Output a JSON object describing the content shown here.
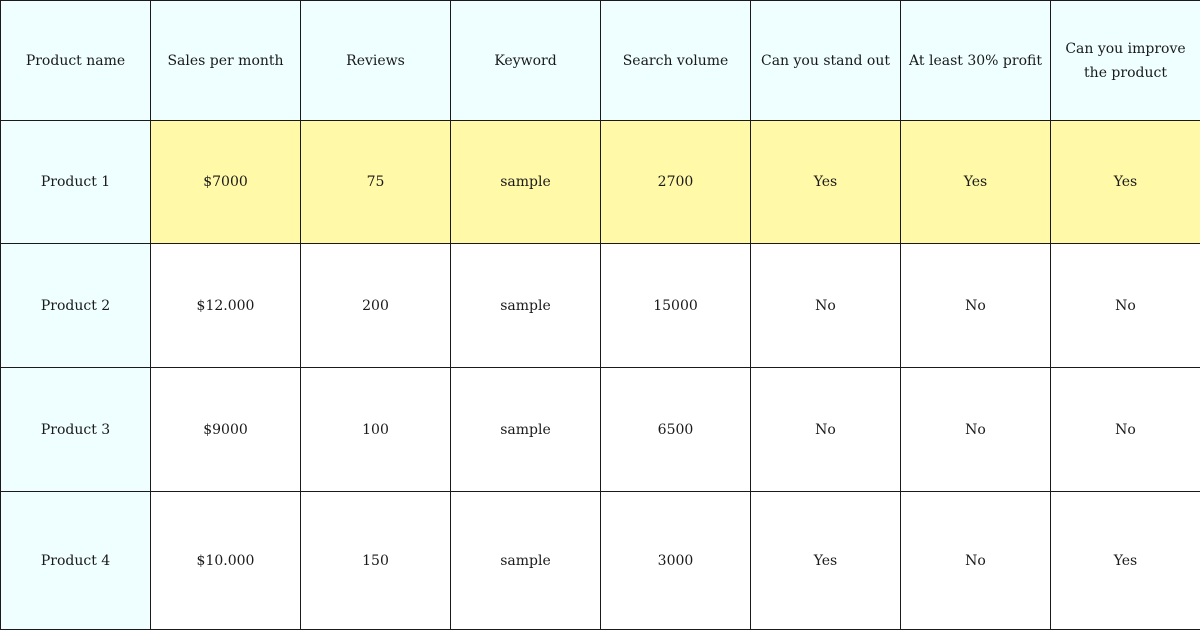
{
  "table": {
    "columns": [
      "Product name",
      "Sales per month",
      "Reviews",
      "Keyword",
      "Search volume",
      "Can you stand out",
      "At least 30% profit",
      "Can you improve the product"
    ],
    "rows": [
      {
        "name": "Product 1",
        "sales": "$7000",
        "reviews": "75",
        "keyword": "sample",
        "search_volume": "2700",
        "stand_out": "Yes",
        "profit_30": "Yes",
        "improve": "Yes",
        "highlighted": true
      },
      {
        "name": "Product 2",
        "sales": "$12.000",
        "reviews": "200",
        "keyword": "sample",
        "search_volume": "15000",
        "stand_out": "No",
        "profit_30": "No",
        "improve": "No",
        "highlighted": false
      },
      {
        "name": "Product 3",
        "sales": "$9000",
        "reviews": "100",
        "keyword": "sample",
        "search_volume": "6500",
        "stand_out": "No",
        "profit_30": "No",
        "improve": "No",
        "highlighted": false
      },
      {
        "name": "Product 4",
        "sales": "$10.000",
        "reviews": "150",
        "keyword": "sample",
        "search_volume": "3000",
        "stand_out": "Yes",
        "profit_30": "No",
        "improve": "Yes",
        "highlighted": false
      }
    ]
  },
  "colors": {
    "header_bg": "#effefe",
    "highlight_bg": "#fff9a8",
    "border": "#1a1a1a"
  }
}
